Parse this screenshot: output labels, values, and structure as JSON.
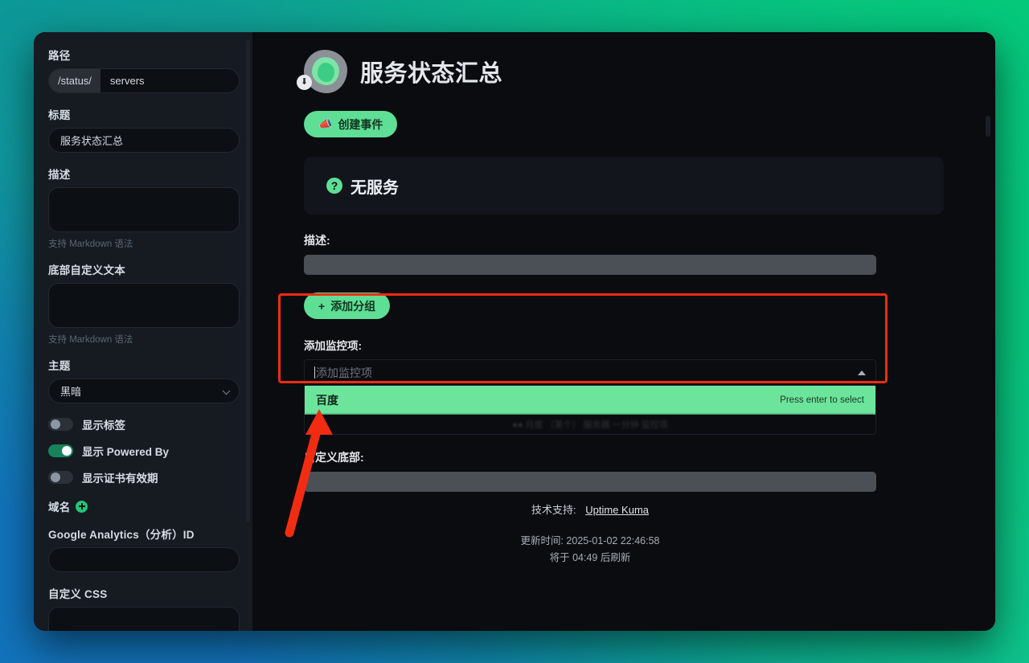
{
  "window": {
    "sidebar": {
      "path": {
        "label": "路径",
        "prefix": "/status/",
        "value": "servers"
      },
      "title": {
        "label": "标题",
        "value": "服务状态汇总"
      },
      "description": {
        "label": "描述",
        "value": "",
        "hint": "支持 Markdown 语法"
      },
      "footer_text": {
        "label": "底部自定义文本",
        "value": "",
        "hint": "支持 Markdown 语法"
      },
      "theme": {
        "label": "主题",
        "value": "黑暗",
        "chevron_icon": "chevron-down-icon"
      },
      "toggles": [
        {
          "label": "显示标签",
          "on": false
        },
        {
          "label": "显示 Powered By",
          "on": true
        },
        {
          "label": "显示证书有效期",
          "on": false
        }
      ],
      "domain": {
        "label": "域名",
        "add_icon": "plus-circle-icon"
      },
      "google_analytics": {
        "label": "Google Analytics（分析）ID",
        "value": ""
      },
      "custom_css": {
        "label": "自定义 CSS",
        "value": ""
      }
    },
    "main": {
      "logo_icon": "uptime-kuma-logo-icon",
      "upload_badge_icon": "upload-icon",
      "page_title": "服务状态汇总",
      "create_event_button": {
        "label": "创建事件",
        "icon": "megaphone-icon"
      },
      "status_card": {
        "icon": "question-mark-icon",
        "text": "无服务"
      },
      "description_field": {
        "label": "描述:",
        "value": ""
      },
      "add_group_button": {
        "label": "添加分组",
        "icon": "plus-icon"
      },
      "add_monitor": {
        "label": "添加监控项:",
        "placeholder": "添加监控项",
        "value": "",
        "arrow_icon": "caret-up-icon",
        "options": [
          {
            "label": "百度",
            "hint": "Press enter to select",
            "highlighted": true
          }
        ]
      },
      "custom_footer": {
        "label": "自定义底部:",
        "value": ""
      },
      "powered_by": {
        "prefix": "技术支持:",
        "link": "Uptime Kuma"
      },
      "refresh": {
        "updated": "更新时间: 2025-01-02 22:46:58",
        "countdown": "将于 04:49 后刷新"
      }
    }
  },
  "annotation": {
    "highlight_color": "#ef2b16",
    "arrow_color": "#f22c12"
  }
}
